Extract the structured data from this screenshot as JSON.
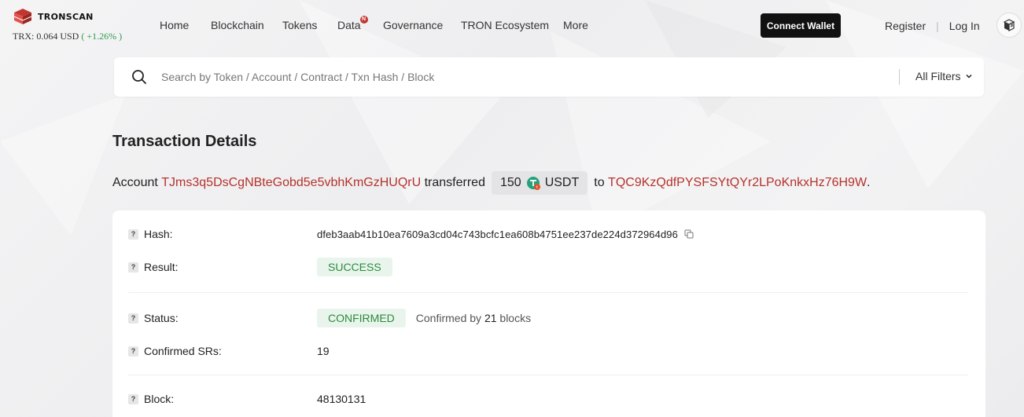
{
  "brand": {
    "name": "TRONSCAN"
  },
  "price": {
    "label": "TRX:",
    "value": "0.064 USD",
    "change": "( +1.26% )"
  },
  "nav": [
    {
      "label": "Home"
    },
    {
      "label": "Blockchain"
    },
    {
      "label": "Tokens"
    },
    {
      "label": "Data",
      "badge": "N"
    },
    {
      "label": "Governance"
    },
    {
      "label": "TRON Ecosystem"
    },
    {
      "label": "More"
    }
  ],
  "header": {
    "connect_label": "Connect Wallet",
    "register_label": "Register",
    "login_label": "Log In",
    "separator": "|"
  },
  "search": {
    "placeholder": "Search by Token / Account / Contract / Txn Hash / Block",
    "filter_label": "All Filters"
  },
  "page": {
    "title": "Transaction Details"
  },
  "summary": {
    "prefix": "Account",
    "from": "TJms3q5DsCgNBteGobd5e5vbhKmGzHUQrU",
    "verb": "transferred",
    "amount": "150",
    "token": "USDT",
    "to_word": "to",
    "to": "TQC9KzQdfPYSFSYtQYr2LPoKnkxHz76H9W",
    "suffix": "."
  },
  "details": {
    "hash_label": "Hash:",
    "hash_value": "dfeb3aab41b10ea7609a3cd04c743bcfc1ea608b4751ee237de224d372964d96",
    "result_label": "Result:",
    "result_value": "SUCCESS",
    "status_label": "Status:",
    "status_value": "CONFIRMED",
    "confirmed_by_prefix": "Confirmed by",
    "confirmed_by_count": "21",
    "confirmed_by_suffix": "blocks",
    "srs_label": "Confirmed SRs:",
    "srs_value": "19",
    "block_label": "Block:",
    "block_value": "48130131",
    "help_glyph": "?"
  },
  "colors": {
    "accent_red": "#b5322c",
    "success_green": "#2b8a3e",
    "success_bg": "#e9f5ec",
    "button_dark": "#111111"
  }
}
